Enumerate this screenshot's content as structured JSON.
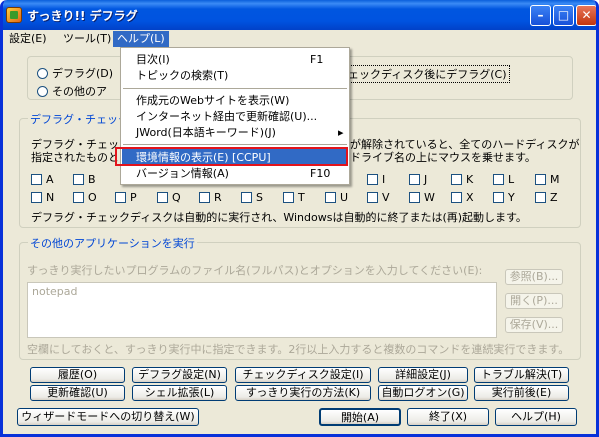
{
  "window": {
    "title": "すっきり!! デフラグ"
  },
  "menubar": {
    "items": [
      "設定(E)",
      "ツール(T)",
      "ヘルプ(L)"
    ]
  },
  "help_menu": {
    "items": [
      {
        "label": "目次(I)",
        "shortcut": "F1"
      },
      {
        "label": "トピックの検索(T)",
        "shortcut": ""
      },
      {
        "label": "作成元のWebサイトを表示(W)",
        "shortcut": ""
      },
      {
        "label": "インターネット経由で更新確認(U)...",
        "shortcut": ""
      },
      {
        "label": "JWord(日本語キーワード)(J)",
        "shortcut": "▸"
      },
      {
        "label": "環境情報の表示(E) [CCPU]",
        "shortcut": ""
      },
      {
        "label": "バージョン情報(A)",
        "shortcut": "F10"
      }
    ]
  },
  "mode": {
    "radio1": "デフラグ(D)",
    "radio2": "その他のア",
    "radio1_suffix": "ェックディスク後にデフラグ(C)"
  },
  "defrag_group": {
    "title": "デフラグ・チェック",
    "desc_line1_left": "デフラグ・チェック",
    "desc_line1_right": "が解除されていると、全てのハードディスクが",
    "desc_line2_left": "指定されたものと",
    "desc_line2_right": "ドライブ名の上にマウスを乗せます。",
    "drives_row1": [
      "A",
      "B",
      "",
      "",
      "",
      "",
      "",
      "",
      "I",
      "J",
      "K",
      "L",
      "M"
    ],
    "drives_row2": [
      "N",
      "O",
      "P",
      "Q",
      "R",
      "S",
      "T",
      "U",
      "V",
      "W",
      "X",
      "Y",
      "Z"
    ],
    "note": "デフラグ・チェックディスクは自動的に実行され、Windowsは自動的に終了または(再)起動します。"
  },
  "apps_group": {
    "title": "その他のアプリケーションを実行",
    "instruction": "すっきり実行したいプログラムのファイル名(フルパス)とオプションを入力してください(E):",
    "textarea_value": "notepad",
    "browse": "参照(B)...",
    "open": "開く(P)...",
    "save": "保存(V)...",
    "hint": "空欄にしておくと、すっきり実行中に指定できます。2行以上入力すると複数のコマンドを連続実行できます。"
  },
  "buttons": {
    "history": "履歴(O)",
    "defrag_settings": "デフラグ設定(N)",
    "check_settings": "チェックディスク設定(I)",
    "detail_settings": "詳細設定(J)",
    "troubleshoot": "トラブル解決(T)",
    "update_check": "更新確認(U)",
    "shell_ext": "シェル拡張(L)",
    "how_to_run": "すっきり実行の方法(K)",
    "auto_logon": "自動ログオン(G)",
    "before_after": "実行前後(E)",
    "wizard": "ウィザードモードへの切り替え(W)",
    "start": "開始(A)",
    "exit": "終了(X)",
    "help": "ヘルプ(H)"
  }
}
